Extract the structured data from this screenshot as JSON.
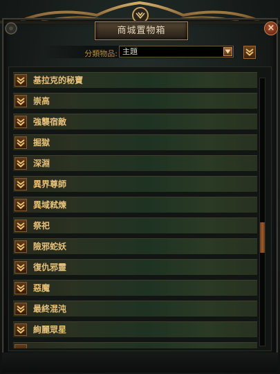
{
  "window": {
    "title": "商城置物箱",
    "close_label": "×"
  },
  "filter": {
    "label": "分類物品:",
    "selected": "主題"
  },
  "list": {
    "items": [
      {
        "label": "基拉克的秘寶"
      },
      {
        "label": "崇高"
      },
      {
        "label": "強襲宿敵"
      },
      {
        "label": "掘獄"
      },
      {
        "label": "深淵"
      },
      {
        "label": "異界尊師"
      },
      {
        "label": "異域弒煉"
      },
      {
        "label": "祭祀"
      },
      {
        "label": "險邪蛇妖"
      },
      {
        "label": "復仇邪靈"
      },
      {
        "label": "惡魔"
      },
      {
        "label": "最終混沌"
      },
      {
        "label": "絢麗眾星"
      }
    ]
  },
  "scrollbar": {
    "position_fraction": 0.58
  },
  "colors": {
    "accent_gold": "#e8c27a",
    "label_orange": "#b88a46",
    "close_red": "#8a3a1c"
  }
}
